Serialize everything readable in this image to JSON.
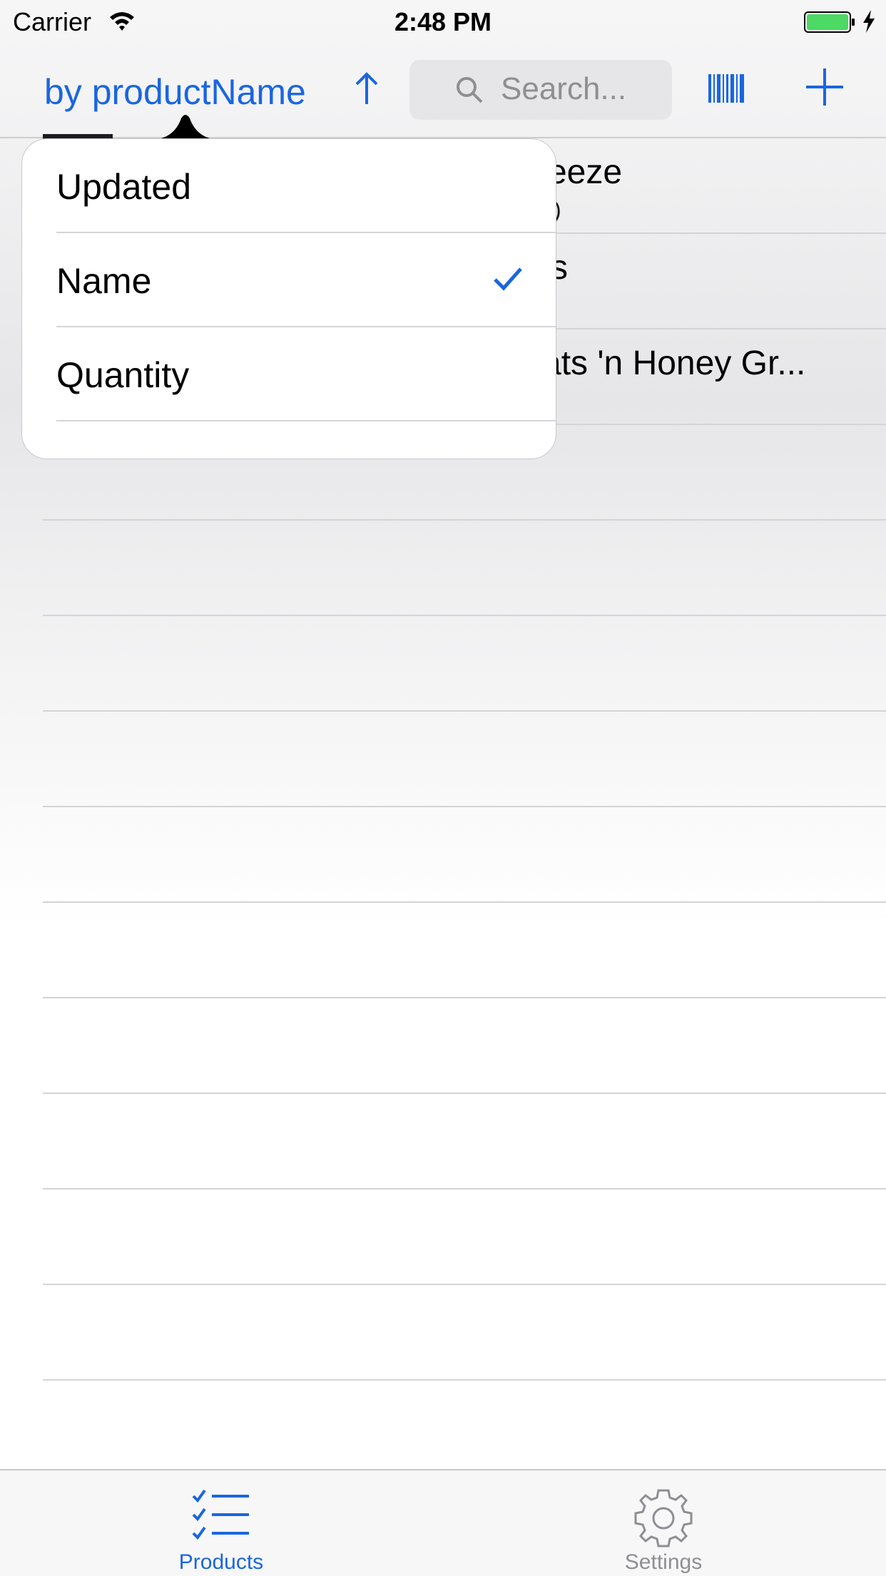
{
  "status_bar": {
    "carrier": "Carrier",
    "time": "2:48 PM"
  },
  "nav": {
    "sort_label": "by productName",
    "search_placeholder": "Search..."
  },
  "list": {
    "rows": [
      {
        "title": "reeze",
        "subtitle": "k)"
      },
      {
        "title": "s",
        "subtitle": ""
      },
      {
        "title": "ats 'n Honey  Gr...",
        "subtitle": ""
      }
    ]
  },
  "sort_menu": {
    "items": [
      {
        "label": "Updated",
        "selected": false
      },
      {
        "label": "Name",
        "selected": true
      },
      {
        "label": "Quantity",
        "selected": false
      },
      {
        "label": "",
        "selected": false
      }
    ]
  },
  "tab_bar": {
    "tabs": [
      {
        "label": "Products",
        "icon": "checklist-icon",
        "active": true
      },
      {
        "label": "Settings",
        "icon": "gear-icon",
        "active": false
      }
    ]
  },
  "colors": {
    "accent": "#1a66e0",
    "battery": "#4cd964",
    "inactive": "#8e8e93"
  }
}
